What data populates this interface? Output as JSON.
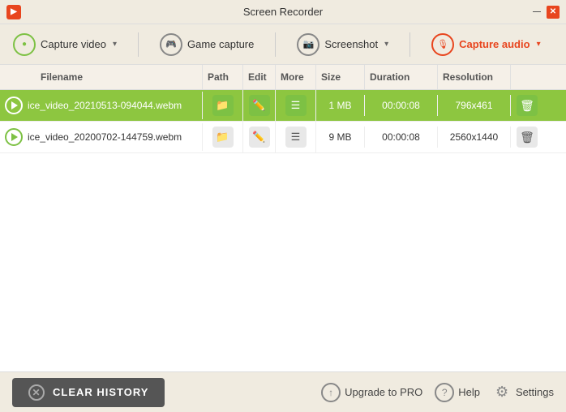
{
  "titlebar": {
    "title": "Screen Recorder",
    "app_icon": "■"
  },
  "toolbar": {
    "capture_video_label": "Capture video",
    "game_capture_label": "Game capture",
    "screenshot_label": "Screenshot",
    "capture_audio_label": "Capture audio"
  },
  "table": {
    "headers": {
      "filename": "Filename",
      "path": "Path",
      "edit": "Edit",
      "more": "More",
      "size": "Size",
      "duration": "Duration",
      "resolution": "Resolution"
    },
    "rows": [
      {
        "filename": "ice_video_20210513-094044.webm",
        "size": "1 MB",
        "duration": "00:00:08",
        "resolution": "796x461",
        "selected": true
      },
      {
        "filename": "ice_video_20200702-144759.webm",
        "size": "9 MB",
        "duration": "00:00:08",
        "resolution": "2560x1440",
        "selected": false
      }
    ]
  },
  "footer": {
    "clear_history_label": "CLEAR HISTORY",
    "upgrade_label": "Upgrade to PRO",
    "help_label": "Help",
    "settings_label": "Settings"
  }
}
